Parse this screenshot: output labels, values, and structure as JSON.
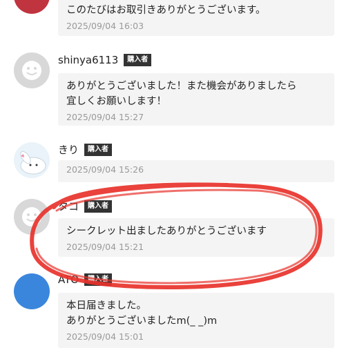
{
  "buyer_badge": "購入者",
  "comments": [
    {
      "name": "",
      "text": "このたびはお取引きありがとうございます。",
      "timestamp": "2025/09/04 16:03"
    },
    {
      "name": "shinya6113",
      "text": "ありがとうございました！また機会がありましたら\n宜しくお願いします！",
      "timestamp": "2025/09/04 15:27"
    },
    {
      "name": "きり",
      "text": "",
      "timestamp": "2025/09/04 15:26"
    },
    {
      "name": "タコ",
      "text": "シークレット出ましたありがとうございます",
      "timestamp": "2025/09/04 15:21"
    },
    {
      "name": "ATO",
      "text": "本日届きました。\nありがとうございましたm(_ _)m",
      "timestamp": "2025/09/04 15:01"
    }
  ],
  "colors": {
    "highlight_circle": "#e8322b",
    "bubble": "#f4f4f4",
    "badge": "#333333"
  }
}
